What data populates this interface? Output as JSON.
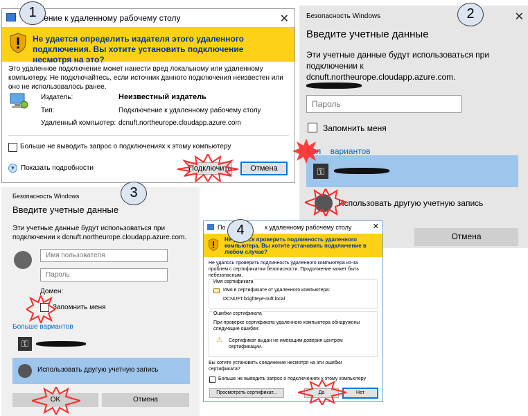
{
  "steps": [
    "1",
    "2",
    "3",
    "4"
  ],
  "win1": {
    "title": "Подключение к удаленному рабочему столу",
    "title_visible": "чение к удаленному рабочему столу",
    "warning": "Не удается определить издателя этого удаленного подключения. Вы хотите установить подключение несмотря на это?",
    "body": "Это удаленное подключение может нанести вред локальному или удаленному компьютеру. Не подключайтесь, если источник данного подключения неизвестен или оно не использовалось ранее.",
    "publisher_label": "Издатель:",
    "publisher_value": "Неизвестный издатель",
    "type_label": "Тип:",
    "type_value": "Подключение к удаленному рабочему столу",
    "remote_label": "Удаленный компьютер:",
    "remote_value": "dcnuft.northeurope.cloudapp.azure.com",
    "dont_ask": "Больше не выводить запрос о подключениях к этому компьютеру",
    "details": "Показать подробности",
    "connect": "Подключить",
    "cancel": "Отмена"
  },
  "win2": {
    "header": "Безопасность Windows",
    "title": "Введите учетные данные",
    "desc": "Эти учетные данные будут использоваться при подключении к dcnuft.northeurope.cloudapp.azure.com.",
    "password_placeholder": "Пароль",
    "remember": "Запомнить меня",
    "more": "Больше вариантов",
    "more_visible": "Бол    вариантов",
    "other_account": "Использовать другую учетную запись",
    "cancel": "Отмена"
  },
  "win3": {
    "header": "Безопасность Windows",
    "title": "Введите учетные данные",
    "desc": "Эти учетные данные будут использоваться при подключении к dcnuft.northeurope.cloudapp.azure.com.",
    "username_placeholder": "Имя пользователя",
    "password_placeholder": "Пароль",
    "domain": "Домен:",
    "remember": "Запомнить меня",
    "more": "Больше вариантов",
    "other_account": "Использовать другую учетную запись",
    "ok": "OK",
    "cancel": "Отмена"
  },
  "win4": {
    "title": "Подключение к удаленному рабочему столу",
    "title_left": "По",
    "title_right": "к удаленному рабочему столу",
    "warning": "Не удается проверить подлинность удаленного компьютера. Вы хотите установить подключение в любом случае?",
    "body": "Не удалось проверить подлинность удаленного компьютера из-за проблем с сертификатом безопасности. Продолжение может быть небезопасным.",
    "cert_name_group": "Имя сертификата",
    "cert_name_text": "Имя в сертификате от удаленного компьютера:",
    "cert_name_value": "DCNUFT.brighteye-nuft.local",
    "cert_errors_group": "Ошибки сертификата",
    "cert_errors_text": "При проверке сертификата удаленного компьютера обнаружены следующие ошибки:",
    "cert_error_item": "Сертификат выдан не имеющим доверия центром сертификации.",
    "question": "Вы хотите установить соединение несмотря на эти ошибки сертификата?",
    "dont_ask": "Больше не выводить запрос о подключениях к этому компьютеру",
    "view_cert": "Просмотреть сертификат...",
    "yes": "Да",
    "no": "Нет"
  },
  "colors": {
    "warning": "#fcd116",
    "accent": "#0078d7",
    "selection": "#9ec5eb",
    "highlight_star": "#ff2a2a"
  }
}
